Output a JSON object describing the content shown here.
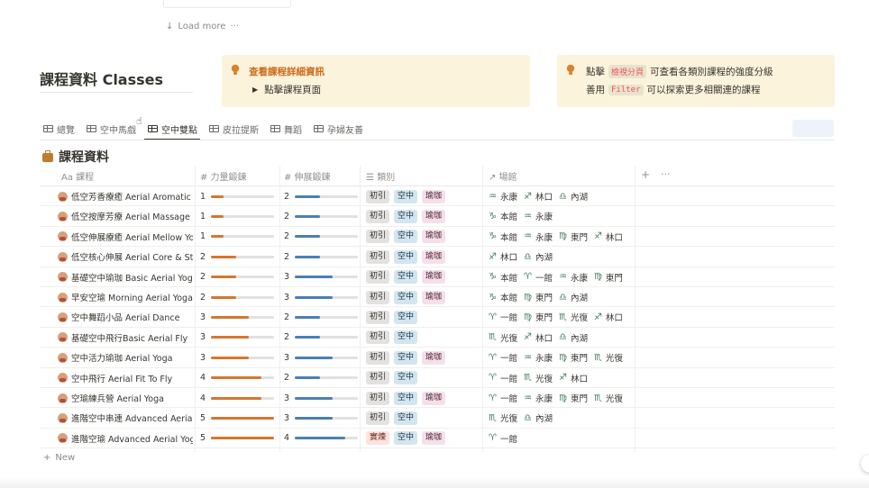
{
  "load_more": {
    "label": "Load more",
    "more_icon": "···"
  },
  "page": {
    "title": "課程資料 Classes"
  },
  "callout1": {
    "title": "查看課程詳細資訊",
    "line": "點擊課程頁面"
  },
  "callout2": {
    "r1_a": "點擊",
    "r1_code": "檢視分頁",
    "r1_b": "可查看各類別課程的強度分級",
    "r2_a": "善用",
    "r2_code": "Filter",
    "r2_b": "可以探索更多相關連的課程"
  },
  "tabs": [
    "總覽",
    "空中馬戲",
    "空中雙點",
    "皮拉提斯",
    "舞蹈",
    "孕婦友善"
  ],
  "active_tab": 2,
  "database": {
    "title": "課程資料"
  },
  "columns": {
    "name": "Aa 課程",
    "strength": "# 力量鍛鍊",
    "stretch": "# 伸展鍛鍊",
    "category": "☰ 類別",
    "venue": "↗ 場館",
    "add": "+",
    "more": "···"
  },
  "colors": {
    "strength_bar": "#d5762f",
    "stretch_bar": "#4a7fb5",
    "callout_title": "#cb6b1b"
  },
  "rows": [
    {
      "name": "低空芳香療癒 Aerial Aromatic M",
      "strength": 1,
      "stretch": 2,
      "tags": [
        [
          "初引",
          "grey"
        ],
        [
          "空中",
          "blue"
        ],
        [
          "瑜珈",
          "pink"
        ]
      ],
      "places": [
        [
          "♒",
          "永康"
        ],
        [
          "♐",
          "林口"
        ],
        [
          "♎",
          "內湖"
        ]
      ]
    },
    {
      "name": "低空按摩芳療 Aerial Massage",
      "strength": 1,
      "stretch": 2,
      "tags": [
        [
          "初引",
          "grey"
        ],
        [
          "空中",
          "blue"
        ],
        [
          "瑜珈",
          "pink"
        ]
      ],
      "places": [
        [
          "♑",
          "本館"
        ],
        [
          "♒",
          "永康"
        ]
      ]
    },
    {
      "name": "低空伸展療癒 Aerial Mellow Yog",
      "strength": 1,
      "stretch": 2,
      "tags": [
        [
          "初引",
          "grey"
        ],
        [
          "空中",
          "blue"
        ],
        [
          "瑜珈",
          "pink"
        ]
      ],
      "places": [
        [
          "♑",
          "本館"
        ],
        [
          "♒",
          "永康"
        ],
        [
          "♍",
          "東門"
        ],
        [
          "♐",
          "林口"
        ]
      ]
    },
    {
      "name": "低空核心伸展 Aerial Core & Stre",
      "strength": 2,
      "stretch": 2,
      "tags": [
        [
          "初引",
          "grey"
        ],
        [
          "空中",
          "blue"
        ],
        [
          "瑜珈",
          "pink"
        ]
      ],
      "places": [
        [
          "♐",
          "林口"
        ],
        [
          "♎",
          "內湖"
        ]
      ]
    },
    {
      "name": "基礎空中瑜珈 Basic Aerial Yoga",
      "strength": 2,
      "stretch": 3,
      "tags": [
        [
          "初引",
          "grey"
        ],
        [
          "空中",
          "blue"
        ],
        [
          "瑜珈",
          "pink"
        ]
      ],
      "places": [
        [
          "♑",
          "本館"
        ],
        [
          "♈",
          "一館"
        ],
        [
          "♒",
          "永康"
        ],
        [
          "♍",
          "東門"
        ]
      ]
    },
    {
      "name": "早安空瑜 Morning Aerial Yoga",
      "strength": 2,
      "stretch": 3,
      "tags": [
        [
          "初引",
          "grey"
        ],
        [
          "空中",
          "blue"
        ],
        [
          "瑜珈",
          "pink"
        ]
      ],
      "places": [
        [
          "♑",
          "本館"
        ],
        [
          "♍",
          "東門"
        ],
        [
          "♎",
          "內湖"
        ]
      ]
    },
    {
      "name": "空中舞蹈小品 Aerial Dance",
      "strength": 3,
      "stretch": 2,
      "tags": [
        [
          "初引",
          "grey"
        ],
        [
          "空中",
          "blue"
        ]
      ],
      "places": [
        [
          "♈",
          "一館"
        ],
        [
          "♍",
          "東門"
        ],
        [
          "♏",
          "光復"
        ],
        [
          "♐",
          "林口"
        ]
      ]
    },
    {
      "name": "基礎空中飛行Basic Aerial Fly",
      "strength": 3,
      "stretch": 2,
      "tags": [
        [
          "初引",
          "grey"
        ],
        [
          "空中",
          "blue"
        ]
      ],
      "places": [
        [
          "♏",
          "光復"
        ],
        [
          "♐",
          "林口"
        ],
        [
          "♎",
          "內湖"
        ]
      ]
    },
    {
      "name": "空中活力瑜珈 Aerial Yoga",
      "strength": 3,
      "stretch": 3,
      "tags": [
        [
          "初引",
          "grey"
        ],
        [
          "空中",
          "blue"
        ],
        [
          "瑜珈",
          "pink"
        ]
      ],
      "places": [
        [
          "♈",
          "一館"
        ],
        [
          "♒",
          "永康"
        ],
        [
          "♍",
          "東門"
        ],
        [
          "♏",
          "光復"
        ]
      ]
    },
    {
      "name": "空中飛行 Aerial Fit To Fly",
      "strength": 4,
      "stretch": 2,
      "tags": [
        [
          "初引",
          "grey"
        ],
        [
          "空中",
          "blue"
        ]
      ],
      "places": [
        [
          "♈",
          "一館"
        ],
        [
          "♏",
          "光復"
        ],
        [
          "♐",
          "林口"
        ]
      ]
    },
    {
      "name": "空瑜練兵營 Aerial Yoga",
      "strength": 4,
      "stretch": 3,
      "tags": [
        [
          "初引",
          "grey"
        ],
        [
          "空中",
          "blue"
        ],
        [
          "瑜珈",
          "pink"
        ]
      ],
      "places": [
        [
          "♈",
          "一館"
        ],
        [
          "♒",
          "永康"
        ],
        [
          "♍",
          "東門"
        ],
        [
          "♏",
          "光復"
        ]
      ]
    },
    {
      "name": "進階空中串連 Advanced Aerial",
      "strength": 5,
      "stretch": 3,
      "tags": [
        [
          "初引",
          "grey"
        ],
        [
          "空中",
          "blue"
        ]
      ],
      "places": [
        [
          "♏",
          "光復"
        ],
        [
          "♎",
          "內湖"
        ]
      ]
    },
    {
      "name": "進階空瑜 Advanced Aerial Yoga",
      "strength": 5,
      "stretch": 4,
      "tags": [
        [
          "實煉",
          "red"
        ],
        [
          "空中",
          "blue"
        ],
        [
          "瑜珈",
          "pink"
        ]
      ],
      "places": [
        [
          "♈",
          "一館"
        ]
      ]
    }
  ],
  "new_row": {
    "label": "New"
  }
}
